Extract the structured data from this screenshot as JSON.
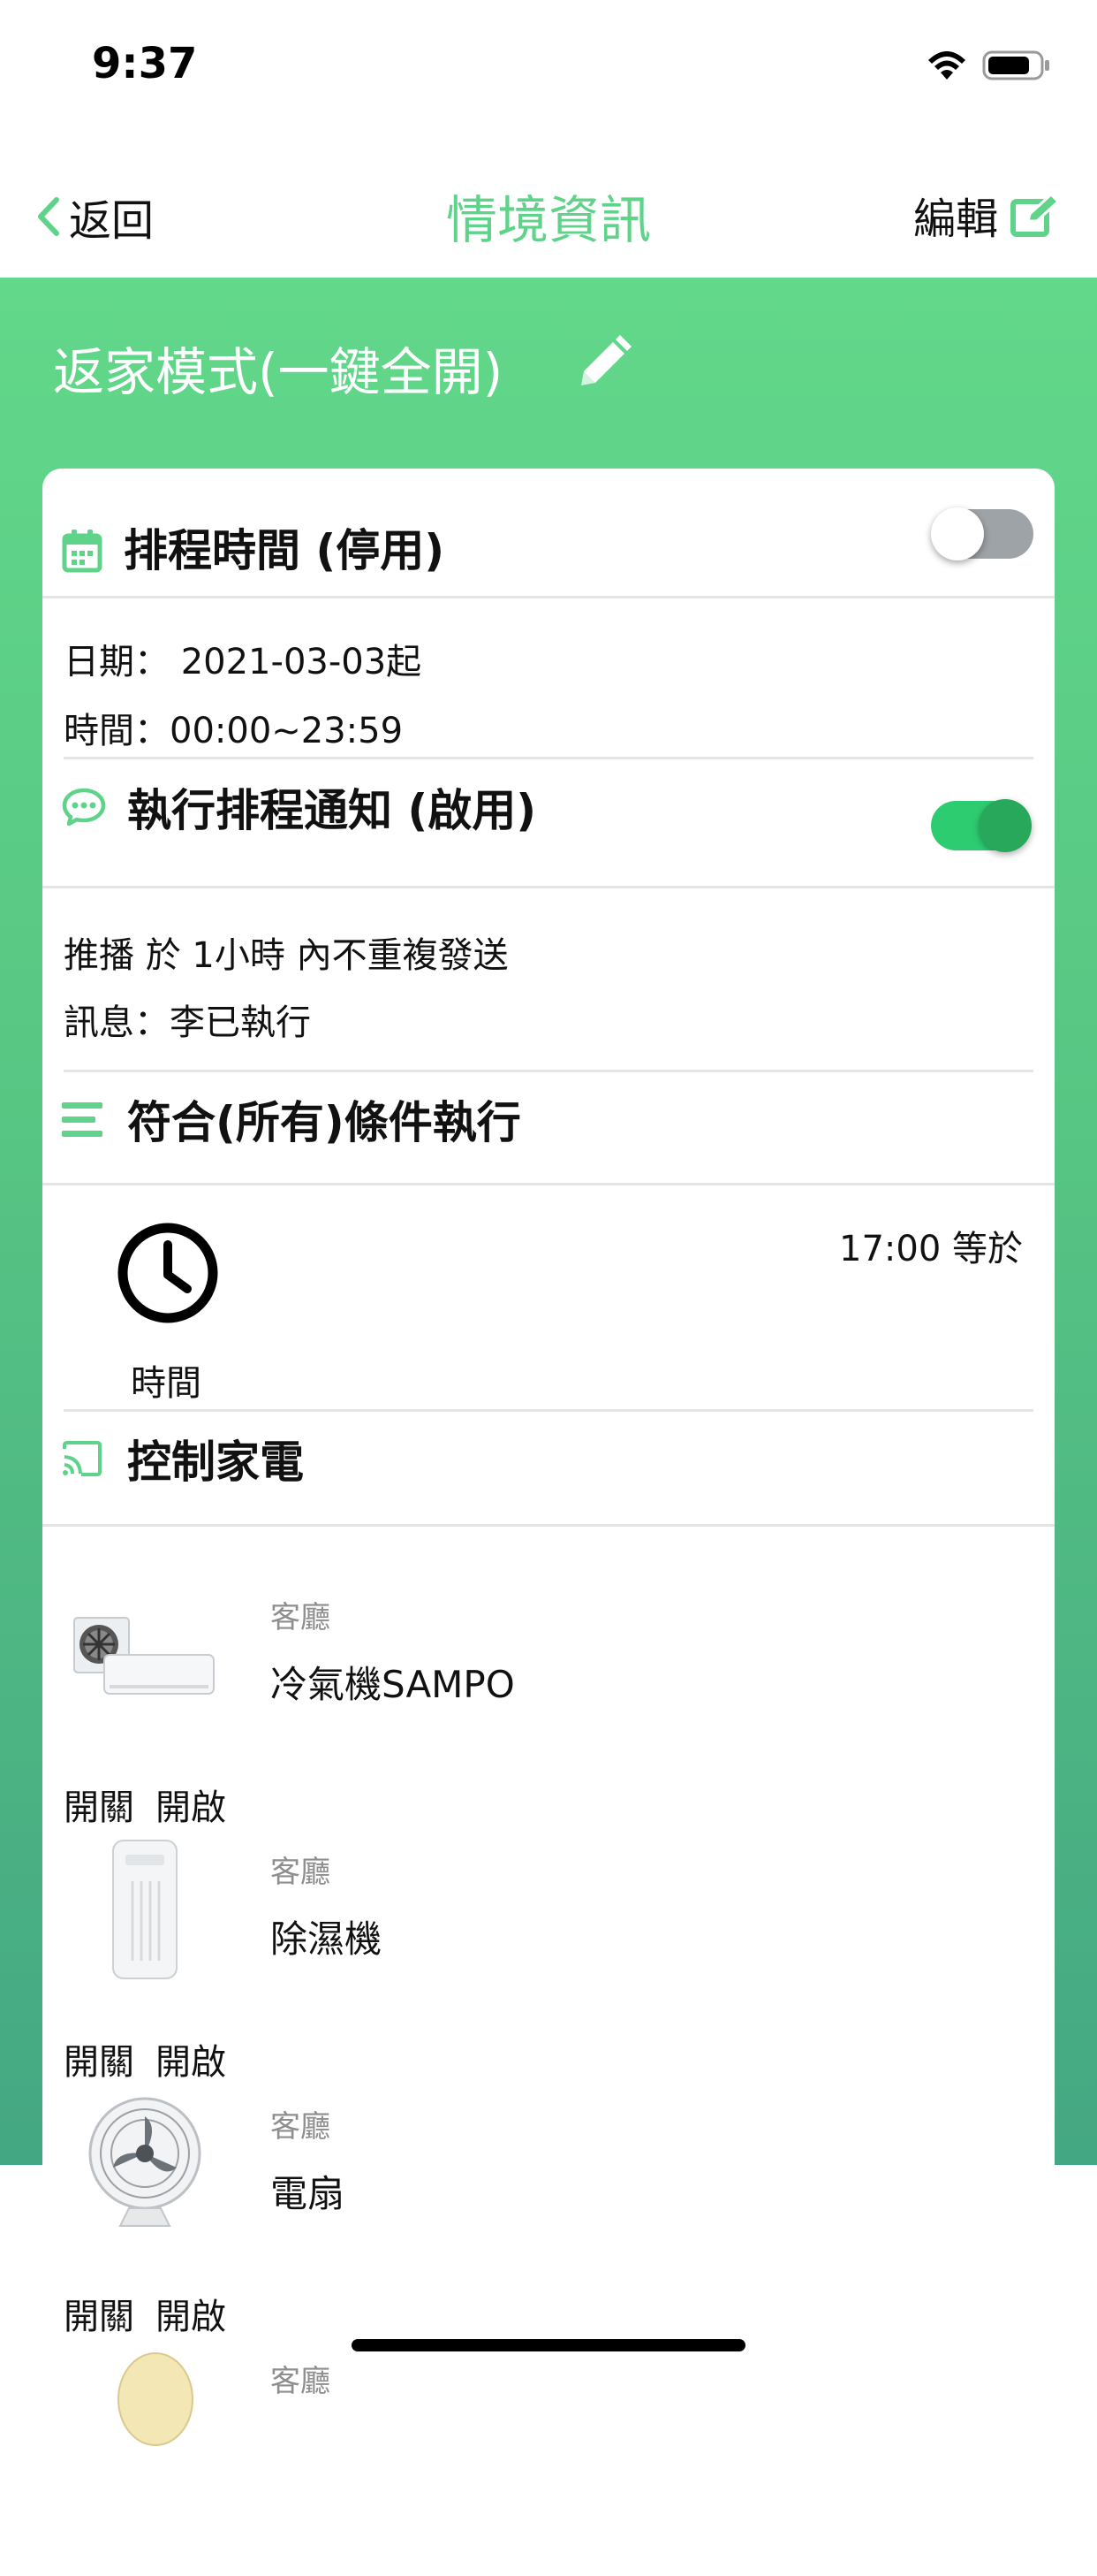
{
  "status": {
    "time": "9:37"
  },
  "nav": {
    "back_label": "返回",
    "title": "情境資訊",
    "edit_label": "編輯"
  },
  "scene": {
    "name": "返家模式(一鍵全開)"
  },
  "schedule": {
    "title": "排程時間 (停用)",
    "enabled": false,
    "date_line": "日期： 2021-03-03起",
    "time_line": "時間：00:00~23:59"
  },
  "notification": {
    "title": "執行排程通知 (啟用)",
    "enabled": true,
    "push_line": "推播  於  1小時 內不重複發送",
    "message_line": "訊息：李已執行"
  },
  "condition": {
    "title": "符合(所有)條件執行",
    "item_label": "時間",
    "item_value": "17:00 等於"
  },
  "control": {
    "title": "控制家電",
    "devices": [
      {
        "room": "客廳",
        "name": "冷氣機SAMPO",
        "action_key": "開關",
        "action_value": "開啟",
        "icon": "air-conditioner-icon"
      },
      {
        "room": "客廳",
        "name": "除濕機",
        "action_key": "開關",
        "action_value": "開啟",
        "icon": "dehumidifier-icon"
      },
      {
        "room": "客廳",
        "name": "電扇",
        "action_key": "開關",
        "action_value": "開啟",
        "icon": "fan-icon"
      },
      {
        "room": "客廳",
        "icon": "lamp-icon"
      }
    ]
  },
  "colors": {
    "accent": "#5fd38a",
    "toggle_on": "#2ecc71",
    "toggle_off": "#9ea3a8"
  }
}
